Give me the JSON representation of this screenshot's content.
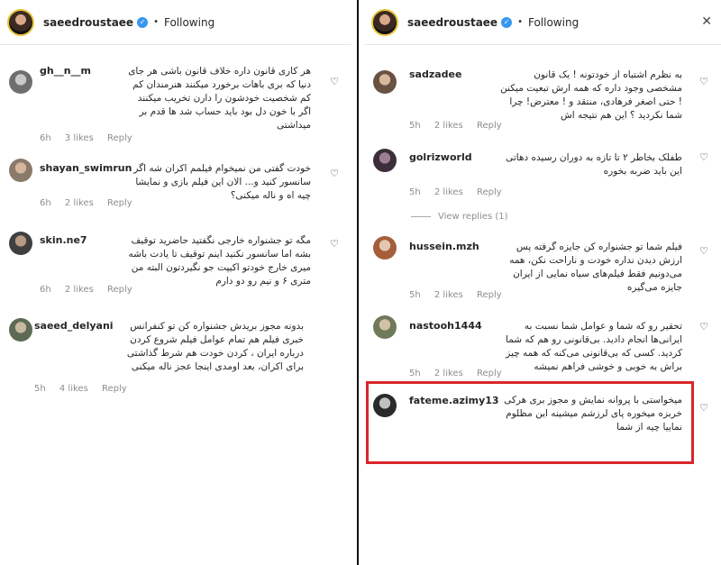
{
  "header": {
    "username": "saeedroustaee",
    "verified_mark": "✓",
    "dot": "•",
    "follow_status": "Following",
    "close_icon": "✕"
  },
  "reply_label": "Reply",
  "left_comments": [
    {
      "user": "gh__n__m",
      "text": "هر کاری قانون داره خلاف قانون باشی هر جای دنیا که بری باهات برخورد میکنند هنرمندان کم کم شخصیت خودشون را دارن تخریب میکنند اگر با خون دل بود باید حساب شد ها قدم بر میداشتی",
      "time": "6h",
      "likes": "3 likes"
    },
    {
      "user": "shayan_swimrun",
      "text": "خودت گفتی من نمیخوام فیلمم اکران شه اگر سانسور کنید و... الان این فیلم بازی و نمایشا چیه اه و ناله میکنی؟",
      "time": "6h",
      "likes": "2 likes"
    },
    {
      "user": "skin.ne7",
      "text": "مگه تو جشنواره خارجی نگفتید حاضرید توقیف بشه اما سانسور نکنید اینم توقیف تا یادت باشه میری خارج خودتو اکیپت جو نگیردتون البته من متری ۶ و نیم رو دو دارم",
      "time": "6h",
      "likes": "2 likes"
    },
    {
      "user": "saeed_delyani",
      "text": "بدونه مجوز بریدش جشنواره کن تو کنفرانس خبری فیلم هم تمام عوامل فیلم شروع کردن درباره ایران ، کردن خودت هم شرط گذاشتی برای اکران، بعد اومدی اینجا عجز ناله میکنی",
      "time": "5h",
      "likes": "4 likes"
    }
  ],
  "right_comments": [
    {
      "user": "sadzadee",
      "text": "به نظرم اشتباه از خودتونه ! یک قانون مشخصی وجود داره که همه ارش تبعیت میکنن ! حتی اصغر فرهادی، منتقد و ! معترض! چرا شما نکردید ؟ این هم نتیجه اش",
      "time": "5h",
      "likes": "2 likes"
    },
    {
      "user": "golrizworld",
      "text": "طفلک بخاطر ۲ تا تازه به دوران رسیده دهاتی این باید ضربه بخوره",
      "time": "5h",
      "likes": "2 likes"
    },
    {
      "user": "hussein.mzh",
      "text": "فیلم شما تو جشنواره کن جایزه گرفته پس ارزش دیدن نداره خودت و ناراحت نکن، همه می‌دونیم فقط فیلم‌های سیاه نمایی از ایران جایزه می‌گیره",
      "time": "5h",
      "likes": "2 likes"
    },
    {
      "user": "nastooh1444",
      "text": "تحقیر رو که شما و عوامل شما نسبت به ایرانی‌ها انجام دادید. بی‌قانونی رو هم که شما کردید. کسی که بی‌قانونی می‌کنه که همه چیز براش به خوبی و خوشی فراهم نمیشه",
      "time": "5h",
      "likes": "2 likes"
    },
    {
      "user": "fateme.azimy13",
      "text": "میخواستی با پروانه نمایش و مجوز بری هرکی خربزه میخوره پای لرزشم میشینه این مظلوم نماییا چیه از شما",
      "time": "",
      "likes": ""
    }
  ],
  "view_replies": "View replies (1)"
}
